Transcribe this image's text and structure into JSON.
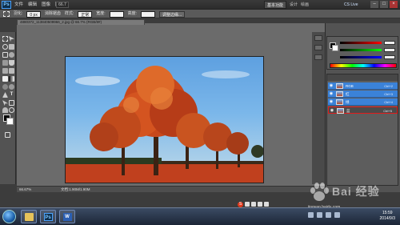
{
  "appbar": {
    "logo": "Ps",
    "menus": [
      "文件",
      "编辑",
      "图像",
      "图层"
    ],
    "zoom_box": "66.7",
    "workspace": "基本功能",
    "workspace_tabs": [
      "设计",
      "绘画"
    ],
    "cs_live": "CS Live"
  },
  "options": {
    "feather_label": "羽化:",
    "feather_value": "0 px",
    "antialias": "消除锯齿",
    "style_label": "样式:",
    "style_value": "正常",
    "width_label": "宽度:",
    "height_label": "高度:",
    "refine_edge": "调整边缘..."
  },
  "document": {
    "tab_title": "4880372_113840509966_2.jpg @ 66.7% (RGB/8#)",
    "zoom_status": "66.67%",
    "doc_size": "文档:1.90M/1.90M"
  },
  "layers": {
    "rows": [
      {
        "name": "RGB",
        "shortcut": "Ctrl+2"
      },
      {
        "name": "红",
        "shortcut": "Ctrl+3"
      },
      {
        "name": "绿",
        "shortcut": "Ctrl+4"
      },
      {
        "name": "蓝",
        "shortcut": "Ctrl+5"
      }
    ]
  },
  "taskbar": {
    "apps": [
      "Ps",
      "W"
    ],
    "time": "15:59",
    "date": "2014/9/3"
  },
  "watermark": {
    "brand": "Bai 经验",
    "url": "jingyan.baidu.com"
  },
  "colors": {
    "accent": "#3b82d8",
    "highlight": "#e21a1a"
  }
}
